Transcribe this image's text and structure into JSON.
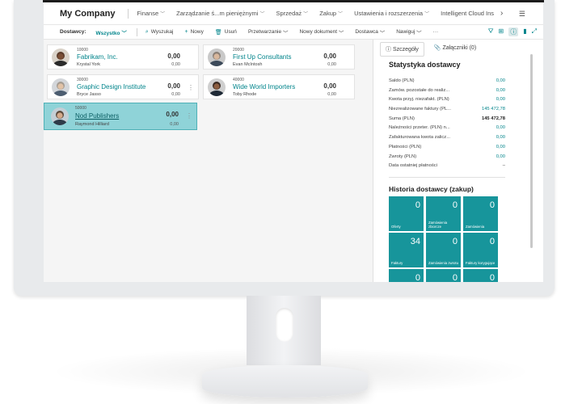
{
  "app": {
    "company": "My Company"
  },
  "nav": {
    "items": [
      "Finanse",
      "Zarządzanie ś...m pieniężnymi",
      "Sprzedaż",
      "Zakup",
      "Ustawienia i rozszerzenia",
      "Intelligent Cloud Ins"
    ],
    "menu_icon": "hamburger-icon"
  },
  "actions": {
    "label": "Dostawcy:",
    "filter": "Wszystko",
    "search": "Wyszukaj",
    "new": "Nowy",
    "delete": "Usuń",
    "processing": "Przetwarzanie",
    "new_document": "Nowy dokument",
    "vendor": "Dostawca",
    "navigate": "Nawiguj",
    "more": "···"
  },
  "vendors": [
    {
      "no": "10000",
      "name": "Fabrikam, Inc.",
      "contact": "Krystal York",
      "amount": "0,00",
      "amount2": "0,00"
    },
    {
      "no": "20000",
      "name": "First Up Consultants",
      "contact": "Evan McIntosh",
      "amount": "0,00",
      "amount2": "0,00"
    },
    {
      "no": "30000",
      "name": "Graphic Design Institute",
      "contact": "Bryce Jasso",
      "amount": "0,00",
      "amount2": "0,00"
    },
    {
      "no": "40000",
      "name": "Wide World Importers",
      "contact": "Toby Rhode",
      "amount": "0,00",
      "amount2": "0,00"
    },
    {
      "no": "50000",
      "name": "Nod Publishers",
      "contact": "Raymond Hilliard",
      "amount": "0,00",
      "amount2": "0,00"
    }
  ],
  "factbox": {
    "tab_details": "Szczegóły",
    "tab_attachments": "Załączniki (0)",
    "stats_title": "Statystyka dostawcy",
    "rows": [
      {
        "label": "Saldo (PLN)",
        "value": "0,00"
      },
      {
        "label": "Zamów. pozostałe do realiz...",
        "value": "0,00"
      },
      {
        "label": "Kwota przyj. niezafakt. (PLN)",
        "value": "0,00"
      },
      {
        "label": "Niezrealizowane faktury (PL...",
        "value": "145 472,78"
      },
      {
        "label": "Suma (PLN)",
        "value": "145 472,78"
      },
      {
        "label": "Należności przeter. (PLN) n...",
        "value": "0,00"
      },
      {
        "label": "Zafakturowana kwota zalicz...",
        "value": "0,00"
      },
      {
        "label": "Płatności (PLN)",
        "value": "0,00"
      },
      {
        "label": "Zwroty (PLN)",
        "value": "0,00"
      },
      {
        "label": "Data ostatniej płatności",
        "value": "–"
      }
    ],
    "history_title": "Historia dostawcy (zakup)",
    "tiles": [
      {
        "value": "0",
        "label": "Oferty"
      },
      {
        "value": "0",
        "label": "Zamówienia zbiorcze"
      },
      {
        "value": "0",
        "label": "Zamówienia"
      },
      {
        "value": "34",
        "label": "Faktury"
      },
      {
        "value": "0",
        "label": "Zamówienia zwrotu"
      },
      {
        "value": "0",
        "label": "Faktury korygujące"
      },
      {
        "value": "0",
        "label": ""
      },
      {
        "value": "0",
        "label": ""
      },
      {
        "value": "0",
        "label": ""
      }
    ]
  }
}
